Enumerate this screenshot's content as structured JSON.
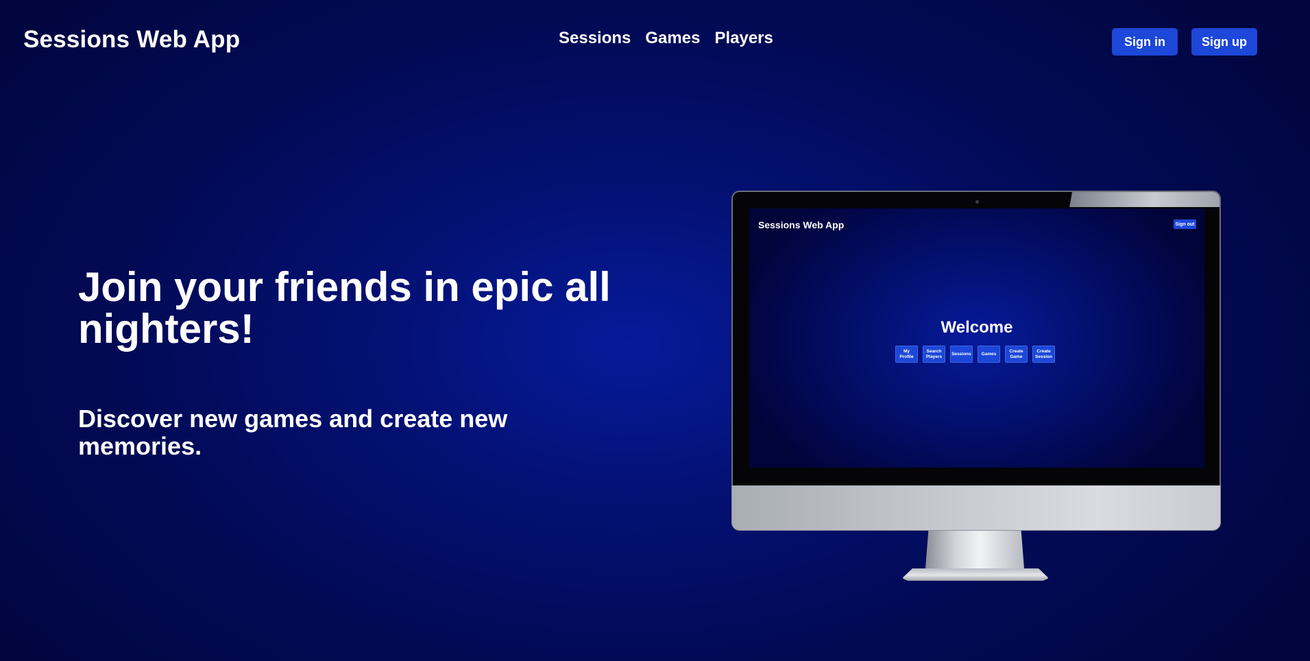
{
  "header": {
    "brand": "Sessions Web App",
    "nav": [
      {
        "label": "Sessions"
      },
      {
        "label": "Games"
      },
      {
        "label": "Players"
      }
    ],
    "sign_in_label": "Sign in",
    "sign_up_label": "Sign up"
  },
  "hero": {
    "title": "Join your friends in epic all nighters!",
    "subtitle": "Discover new games and create new memories."
  },
  "mockup": {
    "brand": "Sessions Web App",
    "sign_out_label": "Sign out",
    "welcome": "Welcome",
    "buttons": [
      {
        "label": "My Profile"
      },
      {
        "label": "Search Players"
      },
      {
        "label": "Sessions"
      },
      {
        "label": "Games"
      },
      {
        "label": "Create Game"
      },
      {
        "label": "Create Session"
      }
    ]
  },
  "colors": {
    "background": "#031070",
    "accent_button": "#1c47d8",
    "text": "#ffffff"
  }
}
